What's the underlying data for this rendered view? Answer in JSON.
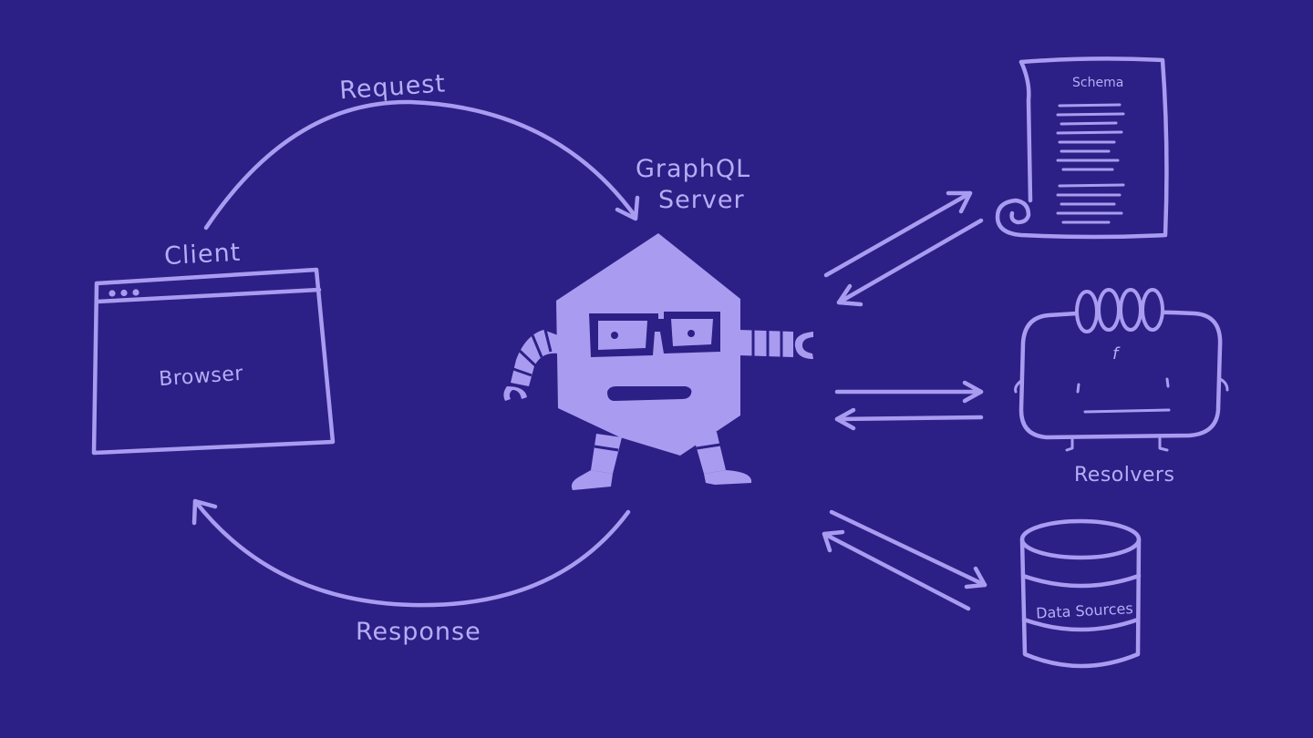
{
  "colors": {
    "background": "#2c1f86",
    "stroke": "#a99cf0",
    "text": "#b7adf5"
  },
  "labels": {
    "request": "Request",
    "response": "Response",
    "client": "Client",
    "browser": "Browser",
    "server_line1": "GraphQL",
    "server_line2": "Server",
    "schema": "Schema",
    "resolvers": "Resolvers",
    "resolver_symbol": "f",
    "data_sources": "Data Sources"
  },
  "icons": [
    "browser-window-icon",
    "graphql-mascot-icon",
    "schema-scroll-icon",
    "resolver-creature-icon",
    "database-icon"
  ]
}
